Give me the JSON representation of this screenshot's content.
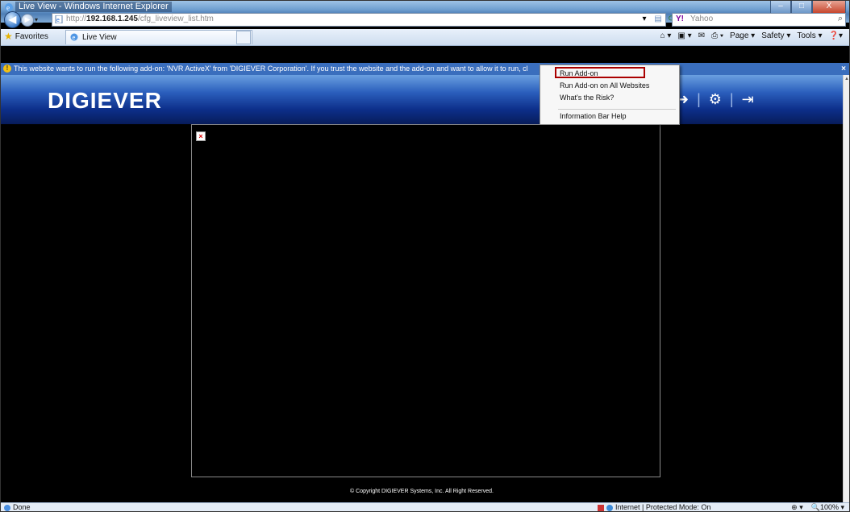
{
  "window": {
    "title": "Live View - Windows Internet Explorer",
    "buttons": [
      "–",
      "□",
      "X"
    ]
  },
  "address": {
    "url_prefix": "http://",
    "url_host": "192.168.1.245",
    "url_path": "/cfg_liveview_list.htm"
  },
  "search": {
    "provider": "Yahoo",
    "placeholder": "Yahoo"
  },
  "favorites": {
    "label": "Favorites",
    "tab_label": "Live View"
  },
  "command_bar": {
    "page": "Page ▾",
    "safety": "Safety ▾",
    "tools": "Tools ▾"
  },
  "info_bar": {
    "text": "This website wants to run the following add-on: 'NVR ActiveX' from 'DIGIEVER Corporation'. If you trust the website and the add-on and want to allow it to run, cl"
  },
  "context_menu": {
    "items": [
      "Run Add-on",
      "Run Add-on on All Websites",
      "What's the Risk?",
      "Information Bar Help"
    ],
    "highlighted": "Run Add-on"
  },
  "page": {
    "logo": "DIGIEVER",
    "copyright": "© Copyright DIGIEVER Systems, Inc. All Right Reserved."
  },
  "status_bar": {
    "status": "Done",
    "zone": "Internet | Protected Mode: On",
    "zoom": "100%"
  }
}
